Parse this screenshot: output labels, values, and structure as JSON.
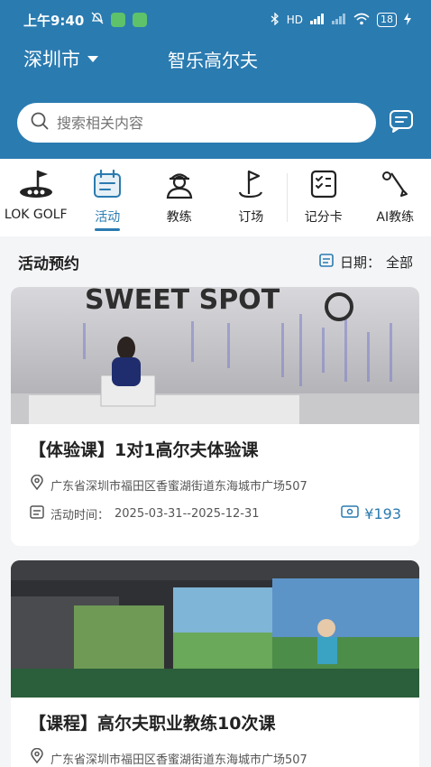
{
  "status_bar": {
    "time": "上午9:40",
    "network": "HD",
    "battery": "18"
  },
  "header": {
    "city": "深圳市",
    "title": "智乐高尔夫"
  },
  "search": {
    "placeholder": "搜索相关内容"
  },
  "nav": [
    {
      "label": "LOK GOLF",
      "icon": "lok-golf-logo-icon"
    },
    {
      "label": "活动",
      "icon": "calendar-icon",
      "active": true
    },
    {
      "label": "教练",
      "icon": "coach-icon"
    },
    {
      "label": "订场",
      "icon": "flag-icon"
    },
    {
      "label": "记分卡",
      "icon": "scorecard-icon"
    },
    {
      "label": "AI教练",
      "icon": "golf-club-icon"
    }
  ],
  "section": {
    "title": "活动预约",
    "date_label": "日期：",
    "date_value": "全部"
  },
  "cards": [
    {
      "image_sign": "SWEET SPOT",
      "title": "【体验课】1对1高尔夫体验课",
      "address": "广东省深圳市福田区香蜜湖街道东海城市广场507",
      "time_label": "活动时间：",
      "time_value": "2025-03-31--2025-12-31",
      "price": "¥193"
    },
    {
      "image_sign": "",
      "title": "【课程】高尔夫职业教练10次课",
      "address": "广东省深圳市福田区香蜜湖街道东海城市广场507"
    }
  ],
  "colors": {
    "primary": "#2a7bb0",
    "background": "#f4f5f7"
  }
}
